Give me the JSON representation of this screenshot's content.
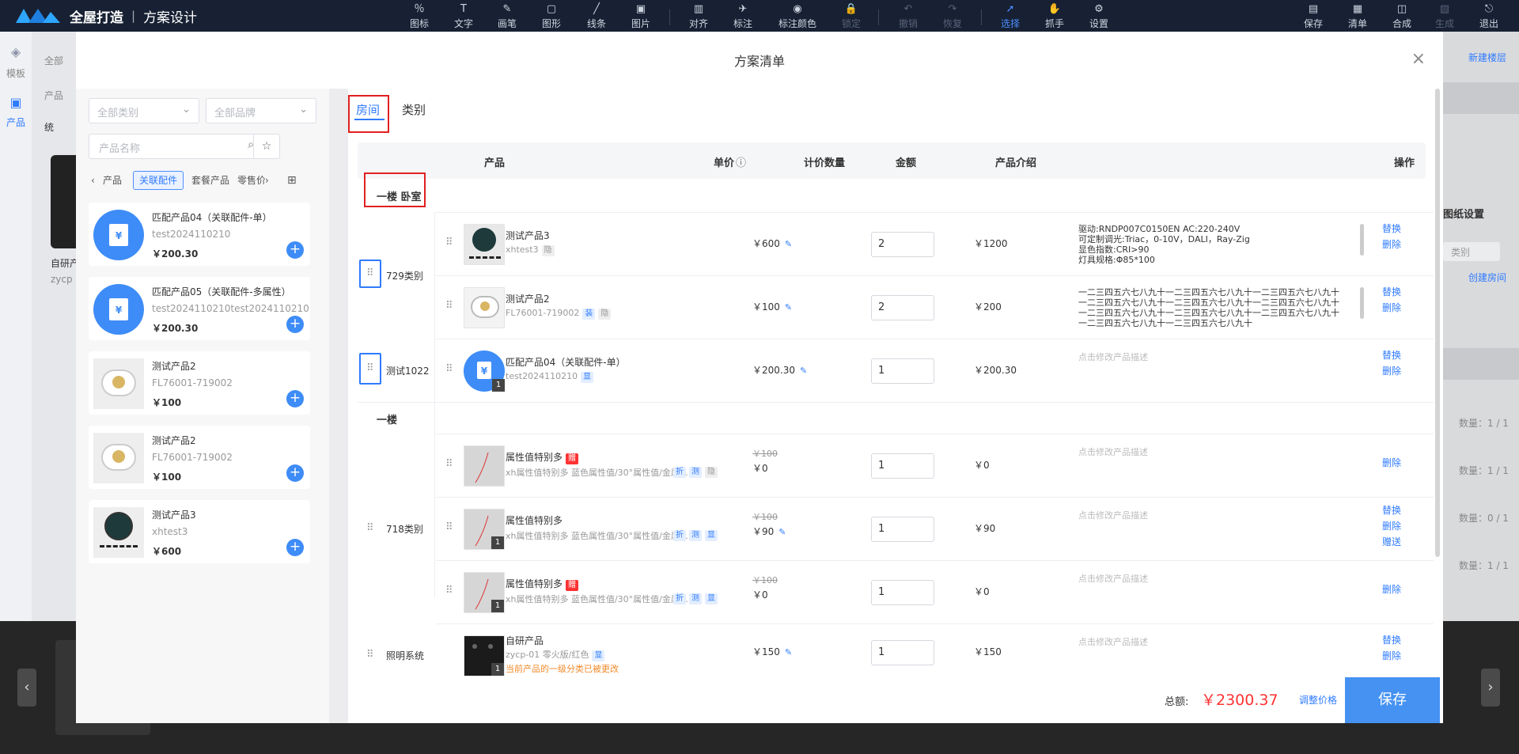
{
  "app": {
    "name": "全屋打造",
    "sep": "|",
    "module": "方案设计"
  },
  "toolbar": {
    "items": [
      {
        "label": "图标",
        "icon": "％"
      },
      {
        "label": "文字",
        "icon": "T"
      },
      {
        "label": "画笔",
        "icon": "✎"
      },
      {
        "label": "图形",
        "icon": "▢"
      },
      {
        "label": "线条",
        "icon": "╱"
      },
      {
        "label": "图片",
        "icon": "▣"
      },
      {
        "label": "对齐",
        "icon": "▥"
      },
      {
        "label": "标注",
        "icon": "✈"
      },
      {
        "label": "标注颜色",
        "icon": "◉"
      },
      {
        "label": "锁定",
        "icon": "🔒"
      },
      {
        "label": "撤销",
        "icon": "↶"
      },
      {
        "label": "恢复",
        "icon": "↷"
      },
      {
        "label": "选择",
        "icon": "➚"
      },
      {
        "label": "抓手",
        "icon": "✋"
      },
      {
        "label": "设置",
        "icon": "⚙"
      }
    ],
    "right": [
      {
        "label": "保存",
        "icon": "▤"
      },
      {
        "label": "清单",
        "icon": "▦"
      },
      {
        "label": "合成",
        "icon": "◫"
      },
      {
        "label": "生成",
        "icon": "▧"
      },
      {
        "label": "退出",
        "icon": "⎋"
      }
    ]
  },
  "side": {
    "mold": "模板",
    "product": "产品"
  },
  "background": {
    "filter1": "全部",
    "filter2": "产品",
    "tabtext": "统",
    "cardtext": "自研产",
    "cardsub": "zycp",
    "new_floor": "新建楼层",
    "paper_settings": "图纸设置",
    "cat_ph": "类别",
    "create_room": "创建房间",
    "counts": [
      "数量：1 / 1",
      "数量：1 / 1",
      "数量：0 / 1",
      "数量：1 / 1"
    ]
  },
  "modal": {
    "title": "方案清单",
    "close": "×"
  },
  "left": {
    "cat_select": "全部类别",
    "brand_select": "全部品牌",
    "search_placeholder": "产品名称",
    "tabs": [
      "产品",
      "关联配件",
      "套餐产品",
      "零售价"
    ],
    "active_tab": 1,
    "cards": [
      {
        "name": "匹配产品04（关联配件-单）",
        "code": "test2024110210",
        "price": "￥200.30",
        "type": "yuan"
      },
      {
        "name": "匹配产品05（关联配件-多属性）",
        "code": "test2024110210test2024110210",
        "price": "￥200.30",
        "type": "yuan"
      },
      {
        "name": "测试产品2",
        "code": "FL76001-719002",
        "price": "￥100",
        "type": "lamp"
      },
      {
        "name": "测试产品2",
        "code": "FL76001-719002",
        "price": "￥100",
        "type": "lamp"
      },
      {
        "name": "测试产品3",
        "code": "xhtest3",
        "price": "￥600",
        "type": "dial"
      }
    ]
  },
  "tabs": {
    "room": "房间",
    "category": "类别"
  },
  "table": {
    "headers": {
      "product": "产品",
      "price": "单价",
      "qty": "计价数量",
      "amount": "金额",
      "intro": "产品介绍",
      "op": "操作"
    },
    "groups": [
      {
        "name": "一楼 卧室"
      },
      {
        "name": "一楼"
      }
    ],
    "categories": [
      "729类别",
      "测试1022",
      "718类别",
      "照明系统"
    ],
    "rows": [
      {
        "name": "测试产品3",
        "sub": "xhtest3",
        "tags": [
          "隐"
        ],
        "price": "￥600",
        "qty": "2",
        "amount": "￥1200",
        "desc": "驱动:RNDP007C0150EN AC:220-240V\n可定制调光:Triac，0-10V，DALI，Ray-Zig\n显色指数:CRI>90\n灯具规格:Φ85*100",
        "ops": [
          "替换",
          "删除"
        ]
      },
      {
        "name": "测试产品2",
        "sub": "FL76001-719002",
        "tags": [
          "装",
          "隐"
        ],
        "price": "￥100",
        "qty": "2",
        "amount": "￥200",
        "desc": "一二三四五六七八九十一二三四五六七八九十一二三四五六七八九十一二三四五六七八九十一二三四五六七八九十一二三四五六七八九十一二三四五六七八九十一二三四五六七八九十一二三四五六七八九十一二三四五六七八九十一二三四五六七八九十",
        "ops": [
          "替换",
          "删除"
        ]
      },
      {
        "name": "匹配产品04（关联配件-单）",
        "sub": "test2024110210",
        "tags": [
          "显"
        ],
        "price": "￥200.30",
        "qty": "1",
        "amount": "￥200.30",
        "desc": "点击修改产品描述",
        "ops": [
          "替换",
          "删除"
        ]
      },
      {
        "name": "属性值特别多",
        "name_tag": "赠",
        "sub": "xh属性值特别多 蓝色属性值/30°属性值/金属…",
        "tags": [
          "折",
          "测",
          "隐"
        ],
        "old_price": "￥100",
        "price": "￥0",
        "qty": "1",
        "amount": "￥0",
        "desc": "点击修改产品描述",
        "ops": [
          "删除"
        ]
      },
      {
        "name": "属性值特别多",
        "sub": "xh属性值特别多 蓝色属性值/30°属性值/金属…",
        "tags": [
          "折",
          "测",
          "显"
        ],
        "old_price": "￥100",
        "price": "￥90",
        "qty": "1",
        "amount": "￥90",
        "desc": "点击修改产品描述",
        "ops": [
          "替换",
          "删除",
          "赠送"
        ]
      },
      {
        "name": "属性值特别多",
        "name_tag": "赠",
        "sub": "xh属性值特别多 蓝色属性值/30°属性值/金属…",
        "tags": [
          "折",
          "测",
          "显"
        ],
        "old_price": "￥100",
        "price": "￥0",
        "qty": "1",
        "amount": "￥0",
        "desc": "点击修改产品描述",
        "ops": [
          "删除"
        ]
      },
      {
        "name": "自研产品",
        "sub": "zycp-01 零火版/红色",
        "tags": [
          "显"
        ],
        "warn": "当前产品的一级分类已被更改",
        "price": "￥150",
        "qty": "1",
        "amount": "￥150",
        "desc": "点击修改产品描述",
        "ops": [
          "替换",
          "删除"
        ]
      }
    ],
    "badge": "1"
  },
  "footer": {
    "total_label": "总额:",
    "total": "￥2300.37",
    "adjust": "调整价格",
    "save": "保存"
  }
}
